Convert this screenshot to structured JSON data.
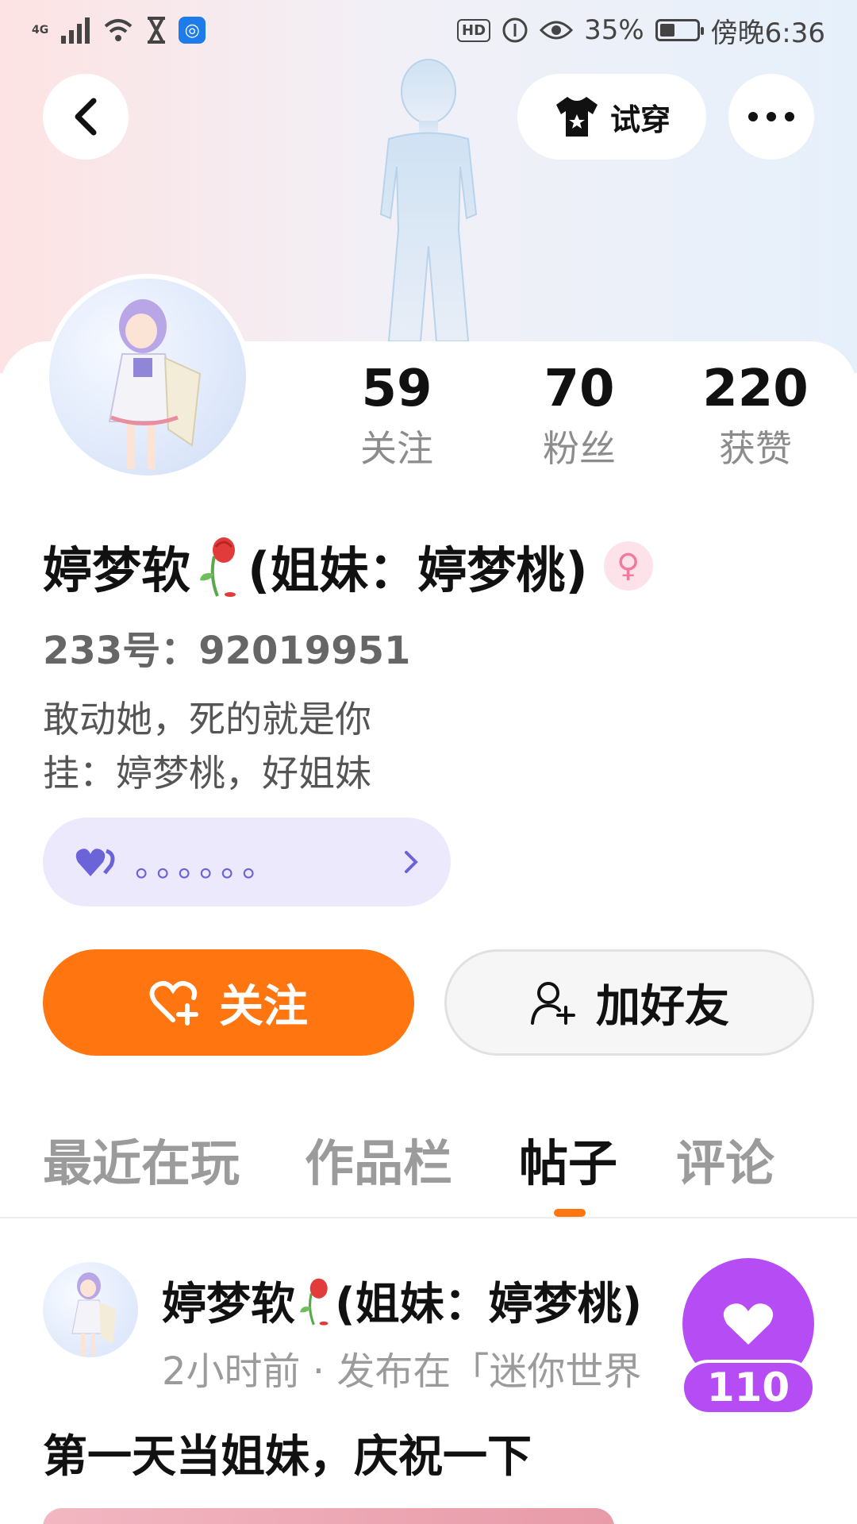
{
  "status_bar": {
    "network": "4G",
    "battery_percent": "35%",
    "time": "傍晚6:36",
    "hd": "HD"
  },
  "header": {
    "try_on_label": "试穿"
  },
  "profile": {
    "stats": [
      {
        "count": "59",
        "label": "关注"
      },
      {
        "count": "70",
        "label": "粉丝"
      },
      {
        "count": "220",
        "label": "获赞"
      }
    ],
    "name_part1": "婷梦软",
    "name_part2": "(姐妹：婷梦桃)",
    "gender_symbol": "♀",
    "uid": "233号：92019951",
    "bio_line1": "敢动她，死的就是你",
    "bio_line2": "挂：婷梦桃，好姐妹",
    "mood_text": "。。。。。。"
  },
  "actions": {
    "follow_label": "关注",
    "add_friend_label": "加好友"
  },
  "tabs": [
    {
      "label": "最近在玩"
    },
    {
      "label": "作品栏"
    },
    {
      "label": "帖子"
    },
    {
      "label": "评论"
    }
  ],
  "active_tab": "帖子",
  "post": {
    "author_part1": "婷梦软",
    "author_part2": "(姐妹：婷梦桃)",
    "meta": "2小时前 · 发布在「迷你世界",
    "title": "第一天当姐妹，庆祝一下"
  },
  "like_fab": {
    "count": "110"
  },
  "colors": {
    "accent_orange": "#ff7611",
    "like_purple": "#b64cf3",
    "mood_bg": "#ebe9fb",
    "mood_text": "#6b63d8"
  }
}
